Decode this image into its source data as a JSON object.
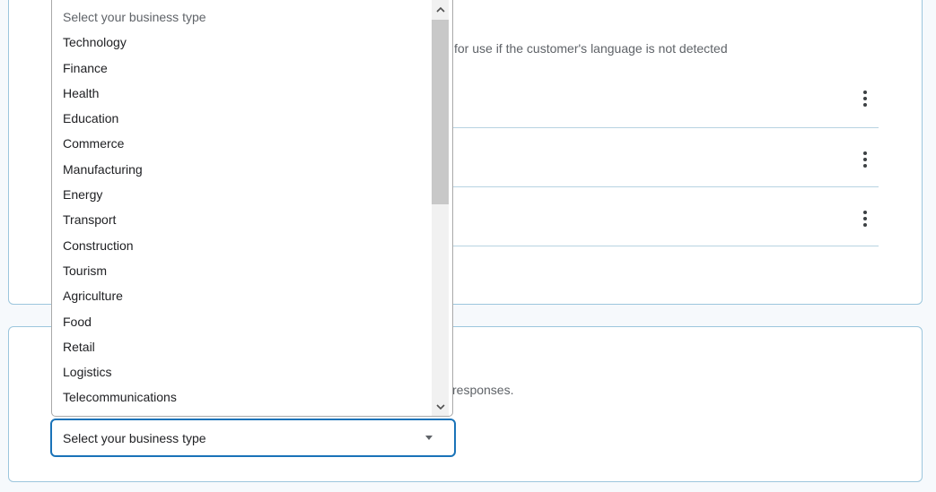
{
  "language_section": {
    "description_visible": "for use if the customer's language is not detected"
  },
  "business_section": {
    "description_visible": "responses.",
    "select_value": "Select your business type"
  },
  "dropdown": {
    "placeholder": "Select your business type",
    "options": [
      "Technology",
      "Finance",
      "Health",
      "Education",
      "Commerce",
      "Manufacturing",
      "Energy",
      "Transport",
      "Construction",
      "Tourism",
      "Agriculture",
      "Food",
      "Retail",
      "Logistics",
      "Telecommunications"
    ]
  },
  "icons": {
    "row_menu": "more-vertical-icon",
    "select_caret": "caret-down-icon",
    "scroll_up": "chevron-up-icon",
    "scroll_down": "chevron-down-icon"
  },
  "colors": {
    "accent": "#1a73b8",
    "card_border": "#9cc6dd",
    "row_divider": "#b7d3e2",
    "background": "#f6f9fc"
  }
}
